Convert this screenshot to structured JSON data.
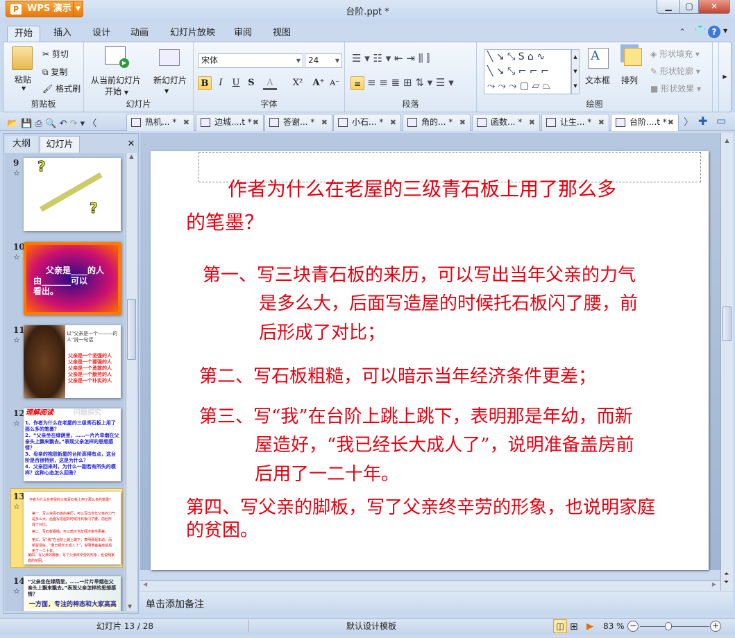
{
  "app": {
    "name": "WPS 演示",
    "title": "台阶.ppt *"
  },
  "menu": {
    "tabs": [
      "开始",
      "插入",
      "设计",
      "动画",
      "幻灯片放映",
      "审阅",
      "视图"
    ],
    "active": "开始"
  },
  "ribbon": {
    "clipboard": {
      "label": "剪贴板",
      "paste": "粘贴",
      "cut": "剪切",
      "copy": "复制",
      "format_painter": "格式刷"
    },
    "slides": {
      "label": "幻灯片",
      "from_current": "从当前幻灯片",
      "from_current2": "开始",
      "new_slide": "新幻灯片"
    },
    "font": {
      "label": "字体",
      "font_name": "宋体",
      "font_size": "24",
      "bold": "B",
      "italic": "I",
      "underline": "U",
      "strike": "S",
      "color": "A",
      "superscript": "X²",
      "grow": "A⁺",
      "shrink": "A⁻"
    },
    "paragraph": {
      "label": "段落"
    },
    "drawing": {
      "label": "绘图",
      "textbox": "文本框",
      "arrange": "排列",
      "shape_fill": "形状填充",
      "shape_outline": "形状轮廓",
      "shape_effect": "形状效果"
    }
  },
  "doc_tabs": [
    {
      "label": "热机... *"
    },
    {
      "label": "边城....t *"
    },
    {
      "label": "答谢... *"
    },
    {
      "label": "小石... *"
    },
    {
      "label": "角的... *"
    },
    {
      "label": "函数... *"
    },
    {
      "label": "让生... *"
    },
    {
      "label": "台阶....t *",
      "active": true
    }
  ],
  "left_pane": {
    "tabs": [
      "大纲",
      "幻灯片"
    ],
    "active": "幻灯片",
    "thumbs": [
      {
        "num": "9"
      },
      {
        "num": "10",
        "text1": "父亲是____的人",
        "text2": "由_______可以",
        "text3": "看出。"
      },
      {
        "num": "11",
        "text": "以\"父亲是一个———的人\"说一句话",
        "items": [
          "父亲是一个坚强的人",
          "父亲是一个要强的人",
          "父亲是一个勇敢的人",
          "父亲是一个勤劳的人",
          "父亲是一个朴实的人"
        ]
      },
      {
        "num": "12",
        "title": "理解阅读",
        "subtitle": "问题探究",
        "items": [
          "1、作者为什么在老屋的三级青石板上用了那么多的笔墨？",
          "2．“父亲坐在绿荫里，……一片片旱烟在父亲头上飘来飘去。”表现父亲怎样的思想感情？",
          "3、母亲的抱怨新屋的台阶高得有点，这台阶是否很特别，这是为什么？",
          "4．父亲回来时，为什么一副若有所失的模样？这种心态怎么回答？"
        ]
      },
      {
        "num": "13",
        "selected": true
      },
      {
        "num": "14",
        "text": "“父亲坐在绿荫里，……一片片旱烟在父亲头上飘来飘去。”表现父亲怎样的思想感情？",
        "note": "一方面，专注的神态和大家高高"
      }
    ]
  },
  "slide": {
    "title_line1": "作者为什么在老屋的三级青石板上用了那么多",
    "title_line2": "的笔墨？",
    "p1": [
      "第一、写三块青石板的来历，可以写出当年父亲的力气",
      "是多么大，后面写造屋的时候托石板闪了腰，前",
      "后形成了对比；"
    ],
    "p2": "第二、写石板粗糙，可以暗示当年经济条件更差；",
    "p3": [
      "第三、写“我”在台阶上跳上跳下，表明那是年幼，而新",
      "屋造好，“我已经长大成人了”，说明准备盖房前",
      "后用了一二十年。"
    ],
    "p4": [
      "第四、写父亲的脚板，写了父亲终辛劳的形象，也说明家庭",
      "的贫困。"
    ],
    "text_color": "#e8000f"
  },
  "notes": {
    "placeholder": "单击添加备注"
  },
  "status": {
    "slide_count": "幻灯片 13 / 28",
    "template": "默认设计模板",
    "zoom": "83 %",
    "zoom_value": 83
  }
}
